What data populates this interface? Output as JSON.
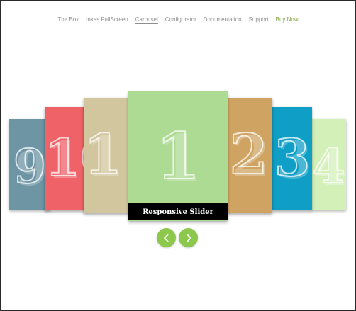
{
  "nav": {
    "items": [
      {
        "label": "The Box"
      },
      {
        "label": "Inkas FullScreen"
      },
      {
        "label": "Carousel"
      },
      {
        "label": "Configurator"
      },
      {
        "label": "Documentation"
      },
      {
        "label": "Support"
      },
      {
        "label": "Buy Now"
      }
    ],
    "active": "Carousel"
  },
  "slides": [
    {
      "number": "9",
      "color": "#6d95a3"
    },
    {
      "number": "10",
      "color": "#ee6268"
    },
    {
      "number": "11",
      "color": "#d2c69e"
    },
    {
      "number": "1",
      "color": "#addb94"
    },
    {
      "number": "2",
      "color": "#cfa362"
    },
    {
      "number": "3",
      "color": "#0f9fc6"
    },
    {
      "number": "4",
      "color": "#d3f0b8"
    }
  ],
  "caption": "Responsive Slider",
  "controls": {
    "accent": "#8cc84b",
    "prev_icon": "chevron-left-icon",
    "next_icon": "chevron-right-icon"
  }
}
